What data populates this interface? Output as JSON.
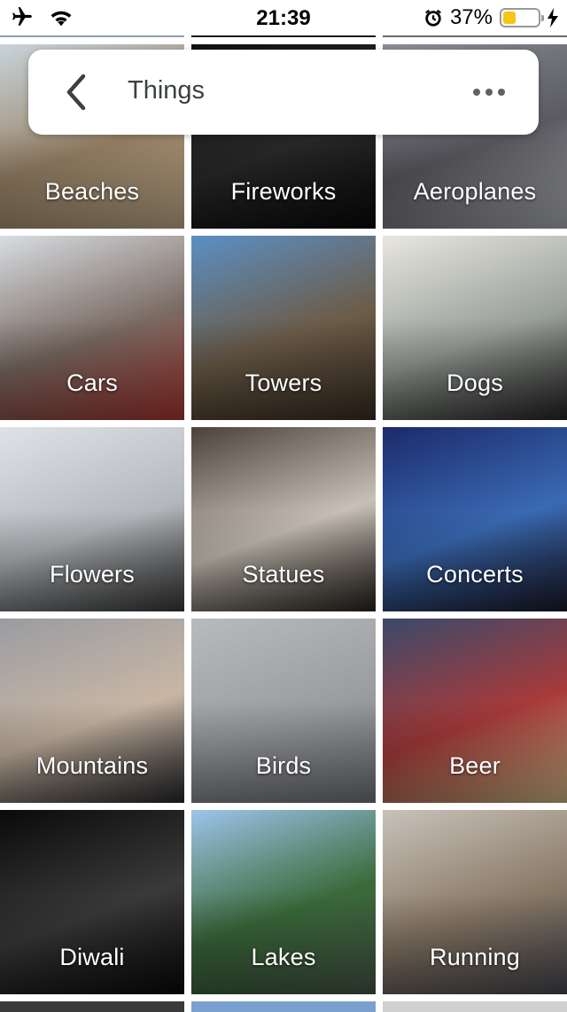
{
  "status_bar": {
    "time": "21:39",
    "battery_percent": "37%",
    "battery_level": 0.37,
    "icons": [
      "airplane-icon",
      "wifi-icon",
      "alarm-icon",
      "battery-icon",
      "charging-icon"
    ]
  },
  "header": {
    "title": "Things",
    "back_icon": "chevron-left-icon",
    "more_icon": "more-horizontal-icon"
  },
  "tiles": [
    {
      "label": "Beaches",
      "colors": [
        "#c8d4dc",
        "#9a8468",
        "#c9b28e"
      ]
    },
    {
      "label": "Fireworks",
      "colors": [
        "#111111",
        "#2a2a2a",
        "#0a0a0a"
      ]
    },
    {
      "label": "Aeroplanes",
      "colors": [
        "#8a8f96",
        "#5a5a60",
        "#b5b7ba"
      ]
    },
    {
      "label": "Cars",
      "colors": [
        "#d8dde2",
        "#7a6a62",
        "#b03a34"
      ]
    },
    {
      "label": "Towers",
      "colors": [
        "#5b8fc4",
        "#6c5c48",
        "#3c3024"
      ]
    },
    {
      "label": "Dogs",
      "colors": [
        "#e8e6e0",
        "#9aa09a",
        "#262626"
      ]
    },
    {
      "label": "Flowers",
      "colors": [
        "#dfe2e6",
        "#b4b8bc",
        "#3a3a3a"
      ]
    },
    {
      "label": "Statues",
      "colors": [
        "#4a423a",
        "#c8c0b6",
        "#2a2520"
      ]
    },
    {
      "label": "Concerts",
      "colors": [
        "#1c2a6a",
        "#3a6ab4",
        "#1a1a2a"
      ]
    },
    {
      "label": "Mountains",
      "colors": [
        "#9a9ca2",
        "#c8b6a4",
        "#2a2a2e"
      ]
    },
    {
      "label": "Birds",
      "colors": [
        "#b8babe",
        "#9a9ca0",
        "#76787c"
      ]
    },
    {
      "label": "Beer",
      "colors": [
        "#3a4a6a",
        "#a83a3a",
        "#d8c08a"
      ]
    },
    {
      "label": "Diwali",
      "colors": [
        "#0a0a0a",
        "#3a3a3a",
        "#0a0a0a"
      ]
    },
    {
      "label": "Lakes",
      "colors": [
        "#9ec4ea",
        "#3a6a3a",
        "#4a5a4a"
      ]
    },
    {
      "label": "Running",
      "colors": [
        "#c8c2ba",
        "#8a7a68",
        "#4a4a52"
      ]
    }
  ]
}
